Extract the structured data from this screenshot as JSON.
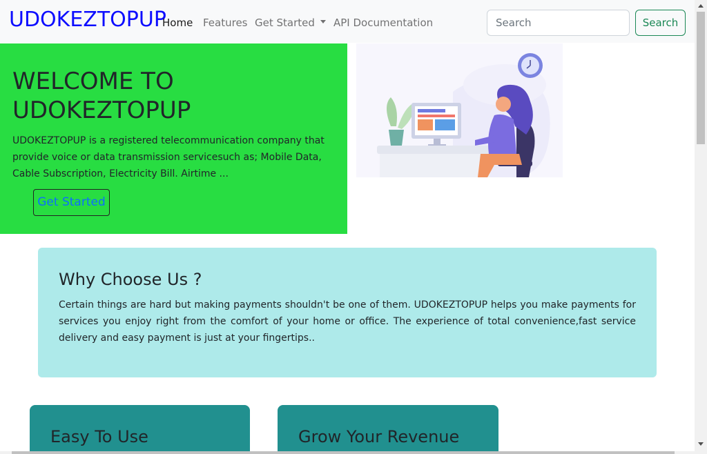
{
  "navbar": {
    "brand": "UDOKEZTOPUP",
    "links": [
      {
        "label": "Home",
        "active": true
      },
      {
        "label": "Features",
        "active": false
      },
      {
        "label": "Get Started",
        "active": false,
        "dropdown": true
      },
      {
        "label": "API Documentation",
        "active": false
      }
    ],
    "search_placeholder": "Search",
    "search_button": "Search"
  },
  "hero": {
    "title": "WELCOME TO UDOKEZTOPUP",
    "text": "UDOKEZTOPUP is a registered telecommunication company that provide voice or data transmission servicesuch as; Mobile Data, Cable Subscription, Electricity Bill. Airtime ...",
    "cta": "Get Started",
    "background": "#28dd42"
  },
  "why": {
    "title": "Why Choose Us ?",
    "text": "Certain things are hard but making payments shouldn't be one of them. UDOKEZTOPUP helps you make payments for services you enjoy right from the comfort of your home or office. The experience of total convenience,fast service delivery and easy payment is just at your fingertips..",
    "background": "#aeeaea"
  },
  "features": [
    {
      "title": "Easy To Use"
    },
    {
      "title": "Grow Your Revenue"
    }
  ],
  "colors": {
    "brand": "#0d0dff",
    "feature_card": "#21908f",
    "search_button": "#198754",
    "cta_text": "#0d6efd"
  }
}
